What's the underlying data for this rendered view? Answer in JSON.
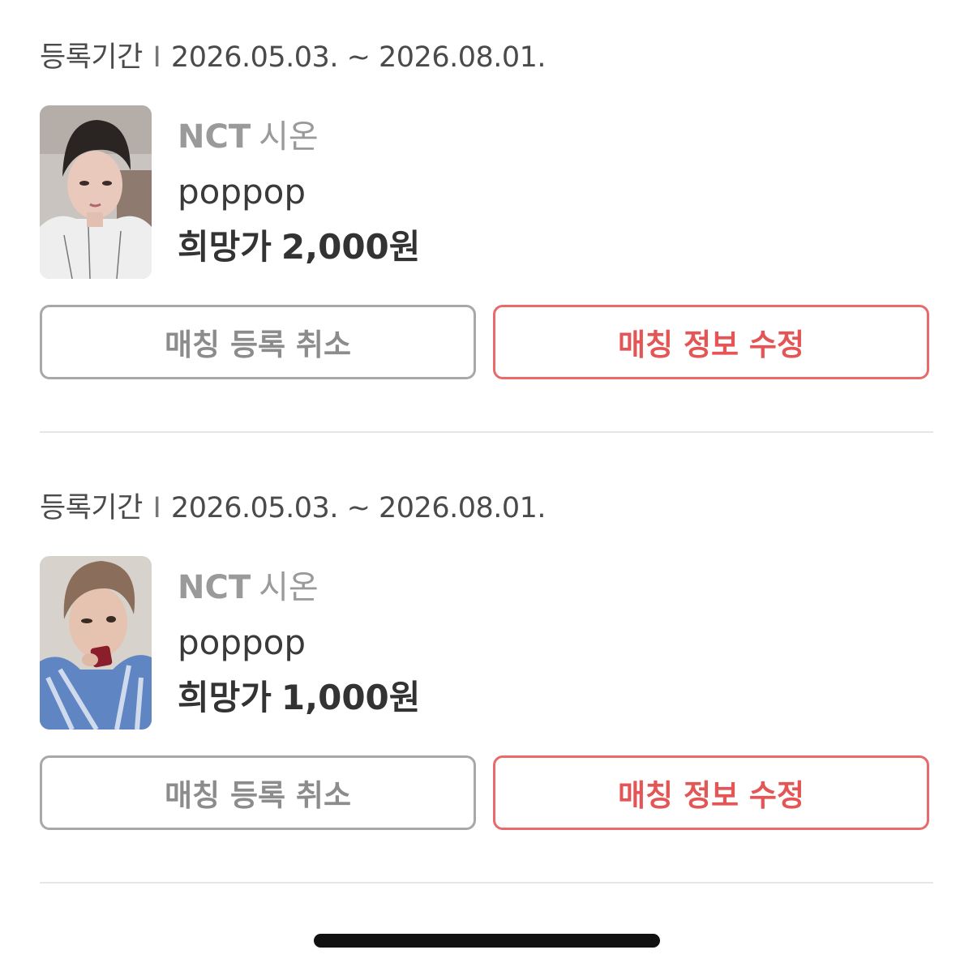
{
  "listings": [
    {
      "period_label": "등록기간",
      "period_separator": "I",
      "period_range": "2026.05.03. ~ 2026.08.01.",
      "photo_alt": "NCT 시온 photocard",
      "group": "NCT",
      "member": "시온",
      "seller": "poppop",
      "price_label": "희망가",
      "price": "2,000원",
      "cancel_button": "매칭 등록 취소",
      "edit_button": "매칭 정보 수정"
    },
    {
      "period_label": "등록기간",
      "period_separator": "I",
      "period_range": "2026.05.03. ~ 2026.08.01.",
      "photo_alt": "NCT 시온 photocard",
      "group": "NCT",
      "member": "시온",
      "seller": "poppop",
      "price_label": "희망가",
      "price": "1,000원",
      "cancel_button": "매칭 등록 취소",
      "edit_button": "매칭 정보 수정"
    }
  ],
  "colors": {
    "accent": "#e45555",
    "accent_border": "#e86a6a",
    "muted_text": "#9a9a9a",
    "neutral_border": "#a8a8a8",
    "divider": "#e6e6e6"
  }
}
